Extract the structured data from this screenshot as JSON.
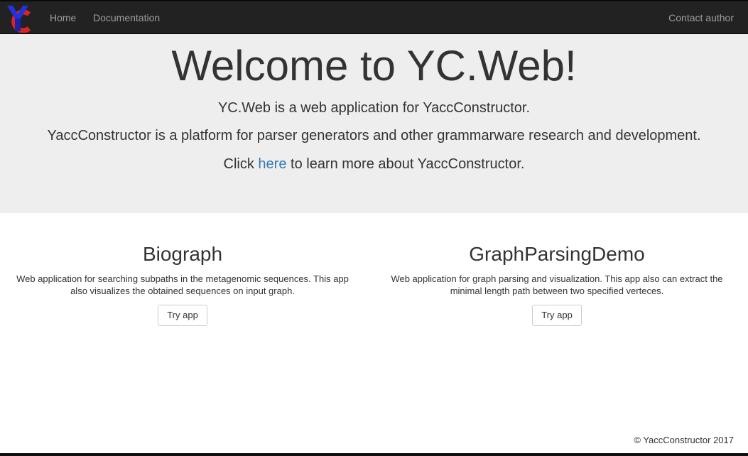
{
  "navbar": {
    "logo_text": "YC",
    "home_label": "Home",
    "docs_label": "Documentation",
    "contact_label": "Contact author"
  },
  "jumbotron": {
    "title": "Welcome to YC.Web!",
    "line1": "YC.Web is a web application for YaccConstructor.",
    "line2": "YaccConstructor is a platform for parser generators and other grammarware research and development.",
    "line3_prefix": "Click ",
    "line3_link": "here",
    "line3_suffix": " to learn more about YaccConstructor."
  },
  "apps": [
    {
      "title": "Biograph",
      "description": "Web application for searching subpaths in the metagenomic sequences. This app also visualizes the obtained sequences on input graph.",
      "button_label": "Try app"
    },
    {
      "title": "GraphParsingDemo",
      "description": "Web application for graph parsing and visualization. This app also can extract the minimal length path between two specified verteces.",
      "button_label": "Try app"
    }
  ],
  "footer": {
    "copyright": "© YaccConstructor 2017"
  },
  "colors": {
    "navbar_bg": "#222222",
    "jumbotron_bg": "#eeeeee",
    "link": "#337ab7",
    "logo_y": "#2233dd",
    "logo_c": "#dd2222"
  }
}
